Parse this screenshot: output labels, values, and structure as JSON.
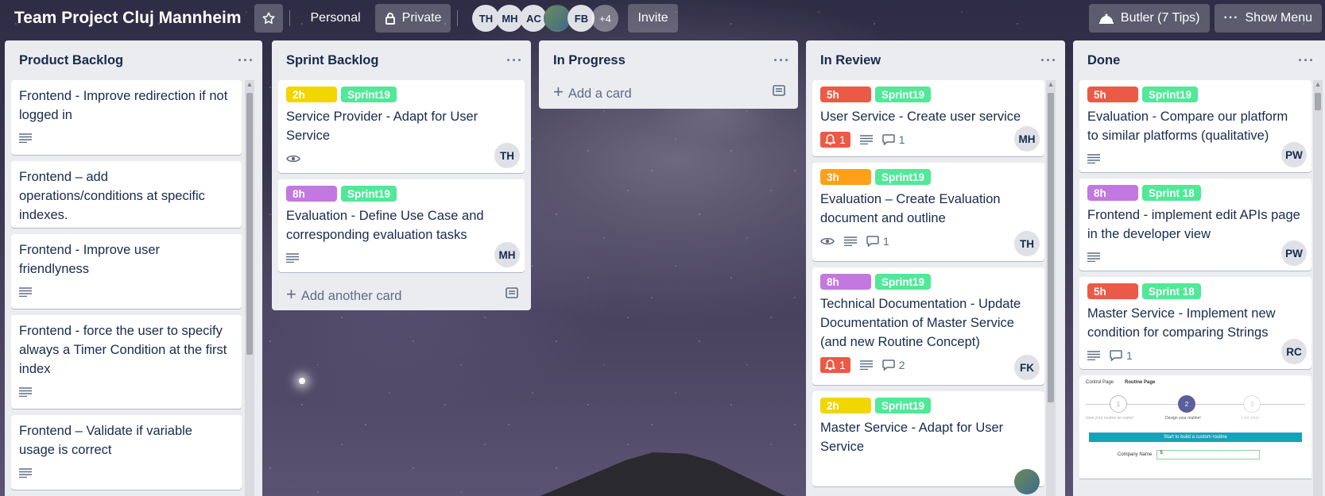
{
  "board": {
    "title": "Team Project Cluj Mannheim",
    "visibility_team": "Personal",
    "visibility_privacy": "Private",
    "members": [
      "TH",
      "MH",
      "AC",
      "",
      "FB"
    ],
    "more_members": "+4",
    "invite_label": "Invite",
    "butler_label": "Butler (7 Tips)",
    "menu_label": "Show Menu"
  },
  "colors": {
    "yellow": "#f2d600",
    "green": "#61bd4f",
    "sprint_green": "#51e898",
    "red": "#eb5a46",
    "orange": "#ff9f1a",
    "purple": "#c377e0"
  },
  "lists": {
    "product_backlog": {
      "title": "Product Backlog",
      "cards": [
        {
          "title": "Frontend - Improve redirection if not logged in"
        },
        {
          "title": "Frontend – add operations/conditions at specific indexes."
        },
        {
          "title": "Frontend - Improve user friendlyness"
        },
        {
          "title": "Frontend - force the user to specify always a Timer Condition at the first index"
        },
        {
          "title": "Frontend – Validate if variable usage is correct"
        }
      ]
    },
    "sprint_backlog": {
      "title": "Sprint Backlog",
      "add_card": "Add another card",
      "cards": [
        {
          "est": "2h",
          "sprint": "Sprint19",
          "title": "Service Provider - Adapt for User Service",
          "member": "TH"
        },
        {
          "est": "8h",
          "sprint": "Sprint19",
          "title": "Evaluation - Define Use Case and corresponding evaluation tasks",
          "member": "MH"
        }
      ]
    },
    "in_progress": {
      "title": "In Progress",
      "add_card": "Add a card"
    },
    "in_review": {
      "title": "In Review",
      "cards": [
        {
          "est": "5h",
          "sprint": "Sprint19",
          "title": "User Service - Create user service",
          "due": "1",
          "comments": "1",
          "member": "MH"
        },
        {
          "est": "3h",
          "sprint": "Sprint19",
          "title": "Evaluation – Create Evaluation document and outline",
          "comments": "1",
          "member": "TH"
        },
        {
          "est": "8h",
          "sprint": "Sprint19",
          "title": "Technical Documentation - Update Documentation of Master Service (and new Routine Concept)",
          "due": "1",
          "comments": "2",
          "member": "FK"
        },
        {
          "est": "2h",
          "sprint": "Sprint19",
          "title": "Master Service - Adapt for User Service"
        }
      ]
    },
    "done": {
      "title": "Done",
      "cards": [
        {
          "est": "5h",
          "sprint": "Sprint19",
          "title": "Evaluation - Compare our platform to similar platforms (qualitative)",
          "member": "PW"
        },
        {
          "est": "8h",
          "sprint": "Sprint 18",
          "title": "Frontend - implement edit APIs page in the developer view",
          "member": "PW"
        },
        {
          "est": "5h",
          "sprint": "Sprint 18",
          "title": "Master Service - Implement new condition for comparing Strings",
          "comments": "1",
          "member": "RC"
        }
      ],
      "preview": {
        "tab1": "Control Page",
        "tab2": "Routine Page",
        "step1": "1",
        "step2": "2",
        "step3": "3",
        "step1_label": "Give your routine an name!",
        "step2_label": "Design your routine!",
        "step3_label": "Last steps",
        "banner": "Start to build a custom routine",
        "field_label": "Company Name",
        "field_value": "$"
      }
    }
  }
}
